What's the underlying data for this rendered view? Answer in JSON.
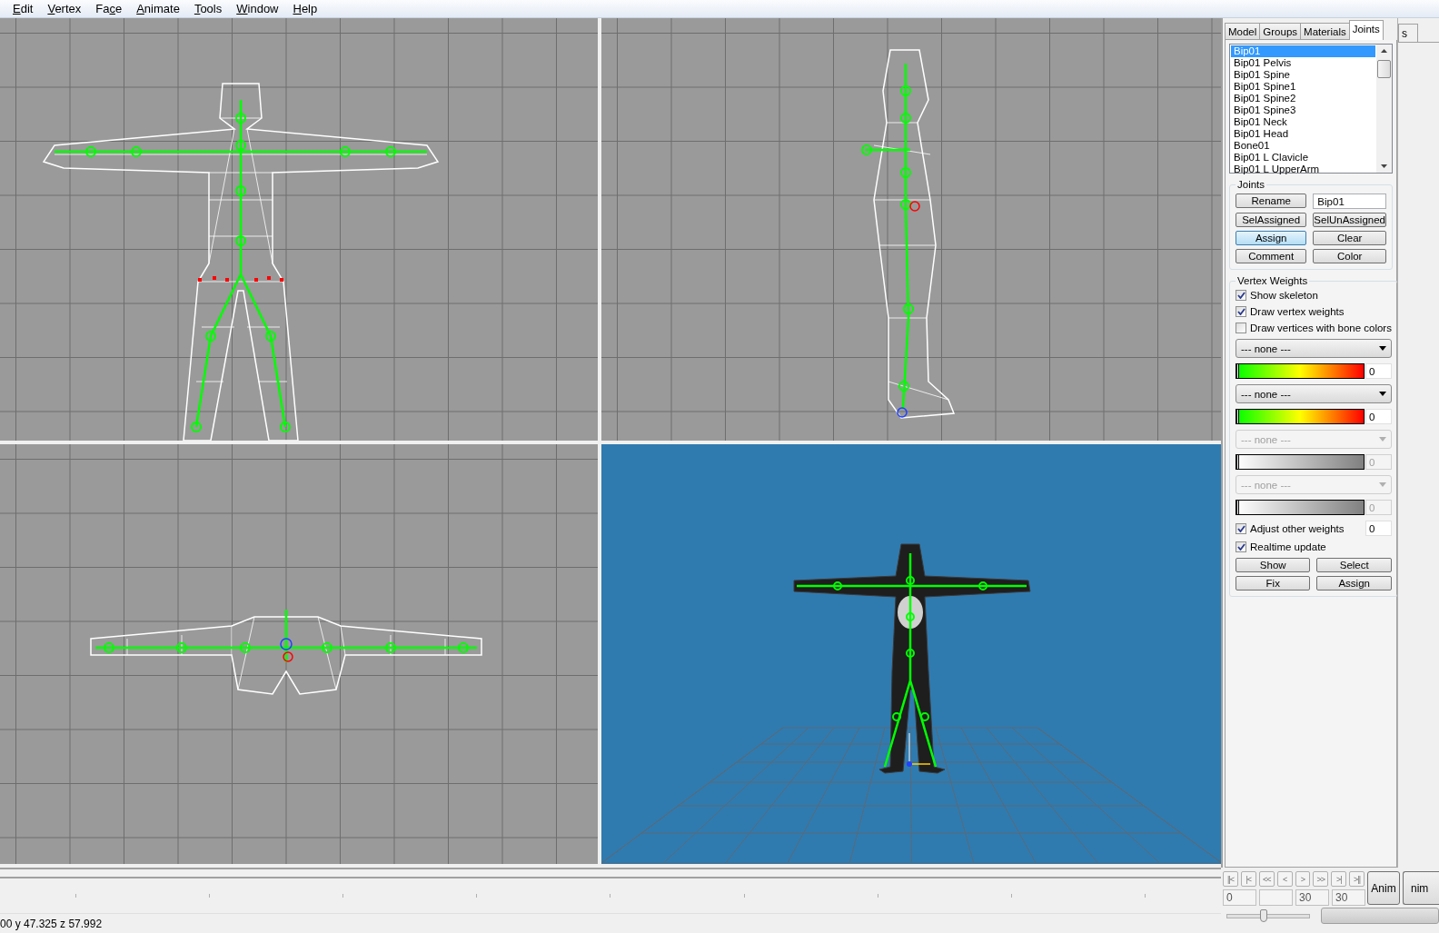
{
  "menu": [
    {
      "accel": "E",
      "rest": "dit"
    },
    {
      "accel": "V",
      "rest": "ertex"
    },
    {
      "before": "Fa",
      "accel": "c",
      "rest": "e"
    },
    {
      "accel": "A",
      "rest": "nimate"
    },
    {
      "accel": "T",
      "rest": "ools"
    },
    {
      "accel": "W",
      "rest": "indow"
    },
    {
      "accel": "H",
      "rest": "elp"
    }
  ],
  "viewports": [
    {
      "kind": "front"
    },
    {
      "kind": "side"
    },
    {
      "kind": "top"
    },
    {
      "kind": "perspective"
    }
  ],
  "panel": {
    "tabs": [
      {
        "label": "Model",
        "selected": false
      },
      {
        "label": "Groups",
        "selected": false
      },
      {
        "label": "Materials",
        "selected": false
      },
      {
        "label": "Joints",
        "selected": true
      },
      {
        "label": "s",
        "selected": false
      }
    ],
    "joints_list": [
      {
        "label": "Bip01",
        "selected": true
      },
      {
        "label": "Bip01 Pelvis",
        "selected": false
      },
      {
        "label": "Bip01 Spine",
        "selected": false
      },
      {
        "label": "Bip01 Spine1",
        "selected": false
      },
      {
        "label": "Bip01 Spine2",
        "selected": false
      },
      {
        "label": "Bip01 Spine3",
        "selected": false
      },
      {
        "label": "Bip01 Neck",
        "selected": false
      },
      {
        "label": "Bip01 Head",
        "selected": false
      },
      {
        "label": "Bone01",
        "selected": false
      },
      {
        "label": "Bip01 L Clavicle",
        "selected": false
      },
      {
        "label": "Bip01 L UpperArm",
        "selected": false
      }
    ],
    "joints_group": {
      "title": "Joints",
      "name_value": "Bip01",
      "buttons": [
        {
          "label": "Rename",
          "pressed": false
        },
        {
          "label": "SelAssigned",
          "pressed": false
        },
        {
          "label": "SelUnAssigned",
          "pressed": false
        },
        {
          "label": "Assign",
          "pressed": true
        },
        {
          "label": "Clear",
          "pressed": false
        },
        {
          "label": "Comment",
          "pressed": false
        },
        {
          "label": "Color",
          "pressed": false
        }
      ]
    },
    "weights_group": {
      "title": "Vertex Weights",
      "options": [
        {
          "label": "Show skeleton",
          "checked": true
        },
        {
          "label": "Draw vertex weights",
          "checked": true
        },
        {
          "label": "Draw vertices with bone colors",
          "checked": false
        }
      ],
      "slots": [
        {
          "selection": "--- none ---",
          "value": "0",
          "level": 0,
          "disabled": false
        },
        {
          "selection": "--- none ---",
          "value": "0",
          "level": 0,
          "disabled": false
        },
        {
          "selection": "--- none ---",
          "value": "0",
          "level": 0,
          "disabled": true
        },
        {
          "selection": "--- none ---",
          "value": "0",
          "level": 0,
          "disabled": true
        }
      ],
      "adjust": {
        "label": "Adjust other weights",
        "checked": true,
        "value": "0"
      },
      "realtime": {
        "label": "Realtime update",
        "checked": true
      },
      "buttons": [
        "Show",
        "Select",
        "Fix",
        "Assign"
      ]
    }
  },
  "playback": {
    "buttons": [
      "||<",
      "|<",
      "<<",
      "<",
      ">",
      ">>",
      ">|",
      ">||"
    ],
    "fields": [
      {
        "kind": "value",
        "value": "0"
      },
      {
        "kind": "blank"
      },
      {
        "kind": "value",
        "value": "30"
      },
      {
        "kind": "value",
        "value": "30"
      }
    ],
    "anim_button": "Anim",
    "cut_button": "nim",
    "slider": {
      "level": 0.45
    }
  },
  "status_bar": {
    "text": "00 y 47.325 z 57.992"
  }
}
